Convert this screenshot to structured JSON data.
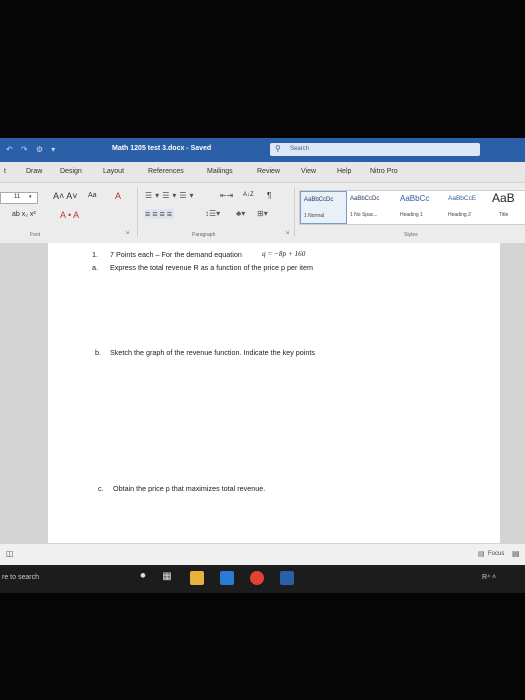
{
  "titlebar": {
    "quick_access": "↶ ↷ ⚙ ▾",
    "document_title": "Math 1205 test 3.docx - Saved",
    "search_label": "Search"
  },
  "tabs": [
    "t",
    "Draw",
    "Design",
    "Layout",
    "References",
    "Mailings",
    "Review",
    "View",
    "Help",
    "Nitro Pro"
  ],
  "ribbon": {
    "font_size": "11",
    "grow_font": "A˄ A˅",
    "change_case": "Aa",
    "clear_format": "A",
    "format_row": "ab x₂ x²",
    "font_color_row": "A • A",
    "font_group": "Font",
    "paragraph_group": "Paragraph",
    "styles_group": "Styles",
    "pilcrow": "¶",
    "sort": "A↓Z",
    "styles": [
      {
        "preview": "AaBbCcDc",
        "name": "1 Normal",
        "selected": true
      },
      {
        "preview": "AaBbCcDc",
        "name": "1 No Spac...",
        "selected": false
      },
      {
        "preview": "AaBbCc",
        "name": "Heading 1",
        "selected": false
      },
      {
        "preview": "AaBbCcE",
        "name": "Heading 2",
        "selected": false
      },
      {
        "preview": "AaB",
        "name": "Title",
        "selected": false
      }
    ]
  },
  "document": {
    "q1_number": "1.",
    "q1_text": "7 Points each – For the demand equation",
    "q1_equation": "q = −8p + 160",
    "qa_label": "a.",
    "qa_text": "Express the total revenue R as a function of the price p per item",
    "qb_label": "b.",
    "qb_text": "Sketch the graph of the revenue function. Indicate the key points",
    "qc_label": "c.",
    "qc_text": "Obtain the price p that maximizes total revenue."
  },
  "statusbar": {
    "focus_label": "Focus"
  },
  "taskbar": {
    "search_text": "re to search",
    "tray_text": "R⁴ ˄"
  },
  "colors": {
    "accent": "#2b5fa8",
    "ribbon_bg": "#ececec",
    "page_bg": "#ffffff",
    "taskbar_bg": "#1c1c1c"
  }
}
